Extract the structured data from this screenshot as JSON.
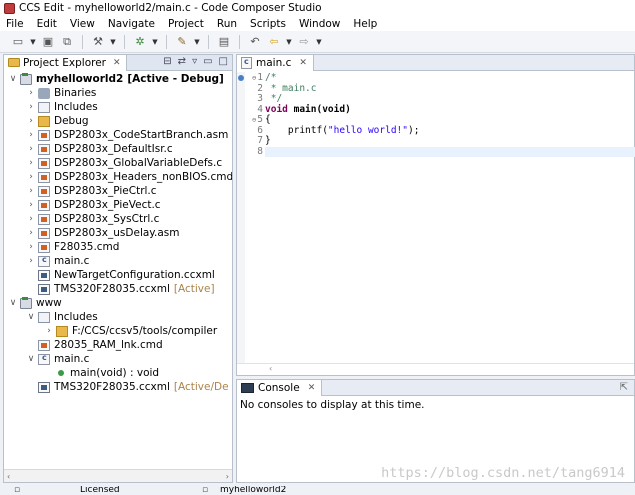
{
  "window": {
    "title": "CCS Edit - myhelloworld2/main.c - Code Composer Studio"
  },
  "menu": [
    "File",
    "Edit",
    "View",
    "Navigate",
    "Project",
    "Run",
    "Scripts",
    "Window",
    "Help"
  ],
  "project_explorer": {
    "tab_label": "Project Explorer",
    "rows": [
      {
        "label": "myhelloworld2",
        "decoration": "[Active - Debug]"
      },
      {
        "label": "Binaries"
      },
      {
        "label": "Includes"
      },
      {
        "label": "Debug"
      },
      {
        "label": "DSP2803x_CodeStartBranch.asm"
      },
      {
        "label": "DSP2803x_DefaultIsr.c"
      },
      {
        "label": "DSP2803x_GlobalVariableDefs.c"
      },
      {
        "label": "DSP2803x_Headers_nonBIOS.cmd"
      },
      {
        "label": "DSP2803x_PieCtrl.c"
      },
      {
        "label": "DSP2803x_PieVect.c"
      },
      {
        "label": "DSP2803x_SysCtrl.c"
      },
      {
        "label": "DSP2803x_usDelay.asm"
      },
      {
        "label": "F28035.cmd"
      },
      {
        "label": "main.c"
      },
      {
        "label": "NewTargetConfiguration.ccxml"
      },
      {
        "label": "TMS320F28035.ccxml",
        "decoration": "[Active]"
      },
      {
        "label": "www"
      },
      {
        "label": "Includes"
      },
      {
        "label": "F:/CCS/ccsv5/tools/compiler"
      },
      {
        "label": "28035_RAM_lnk.cmd"
      },
      {
        "label": "main.c"
      },
      {
        "label": "main(void) : void"
      },
      {
        "label": "TMS320F28035.ccxml",
        "decoration": "[Active/De"
      }
    ]
  },
  "editor": {
    "tab_label": "main.c",
    "line_numbers": [
      "1",
      "2",
      "3",
      "4",
      "5",
      "6",
      "7",
      "8"
    ],
    "lines": {
      "l1": "/*",
      "l2": " * main.c",
      "l3": " */",
      "l4_kw": "void",
      "l4_rest": " main(void)",
      "l5": "{",
      "l6_pre": "    printf(",
      "l6_str": "\"hello world!\"",
      "l6_post": ");",
      "l7": "}",
      "l8": ""
    }
  },
  "console": {
    "tab_label": "Console",
    "message": "No consoles to display at this time."
  },
  "watermark": "https://blog.csdn.net/tang6914",
  "status": {
    "license": "Licensed",
    "project": "myhelloworld2"
  }
}
